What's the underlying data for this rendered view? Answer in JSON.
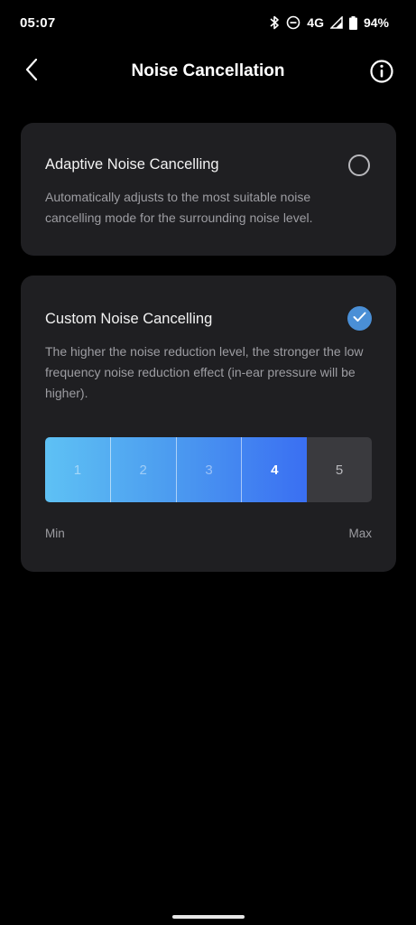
{
  "status_bar": {
    "time": "05:07",
    "network": "4G",
    "battery": "94%",
    "icons": [
      "bluetooth-icon",
      "do-not-disturb-icon",
      "signal-icon",
      "battery-icon"
    ]
  },
  "header": {
    "title": "Noise Cancellation",
    "back_icon": "chevron-left-icon",
    "info_icon": "info-icon"
  },
  "adaptive": {
    "title": "Adaptive Noise Cancelling",
    "description": "Automatically adjusts to the most suitable noise cancelling mode for the surrounding noise level.",
    "selected": false
  },
  "custom": {
    "title": "Custom Noise Cancelling",
    "description": "The higher the noise reduction level, the stronger the low frequency noise reduction effect (in-ear pressure will be higher).",
    "selected": true,
    "levels": [
      "1",
      "2",
      "3",
      "4",
      "5"
    ],
    "selected_level": 4,
    "min_label": "Min",
    "max_label": "Max"
  },
  "colors": {
    "accent": "#4a8fd6",
    "card_bg": "#1f1f22",
    "gradient_start": "#5ec1f4",
    "gradient_end": "#3a6ff2"
  }
}
